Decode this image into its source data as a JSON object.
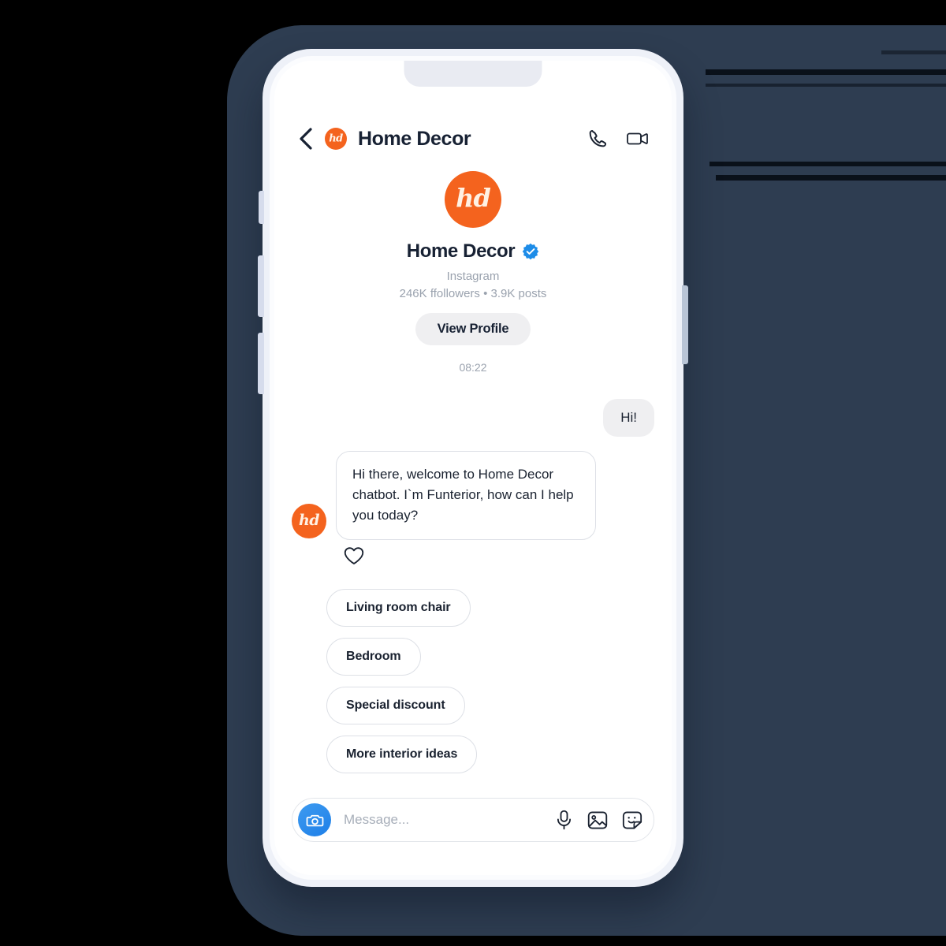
{
  "backdrop": {
    "color": "#2E3D51"
  },
  "brand": {
    "accent_orange": "#F4631E",
    "verified_blue": "#1D8CE8",
    "camera_blue": "#2C8AEC"
  },
  "phone": {
    "buttons": [
      "mute-switch",
      "volume-up-button",
      "volume-down-button",
      "power-button"
    ],
    "notch": "notch"
  },
  "header": {
    "back_icon": "chevron-left-icon",
    "avatar_initials": "hd",
    "title": "Home Decor",
    "call_icon": "phone-icon",
    "video_icon": "video-camera-icon"
  },
  "profile": {
    "avatar_initials": "hd",
    "name": "Home Decor",
    "verified_icon": "verified-badge-icon",
    "platform": "Instagram",
    "stats": "246K ffollowers • 3.9K posts",
    "view_profile_label": "View Profile",
    "timestamp": "08:22"
  },
  "messages": [
    {
      "from": "user",
      "text": "Hi!"
    },
    {
      "from": "bot",
      "avatar_initials": "hd",
      "text": "Hi there, welcome to Home Decor chatbot. I`m Funterior, how can I help you today?",
      "reaction_icon": "heart-outline-icon"
    }
  ],
  "quick_replies": [
    {
      "label": "Living room chair"
    },
    {
      "label": "Bedroom"
    },
    {
      "label": "Special discount"
    },
    {
      "label": "More interior ideas"
    }
  ],
  "composer": {
    "camera_icon": "camera-icon",
    "placeholder": "Message...",
    "mic_icon": "microphone-icon",
    "gallery_icon": "image-icon",
    "sticker_icon": "sticker-icon"
  }
}
